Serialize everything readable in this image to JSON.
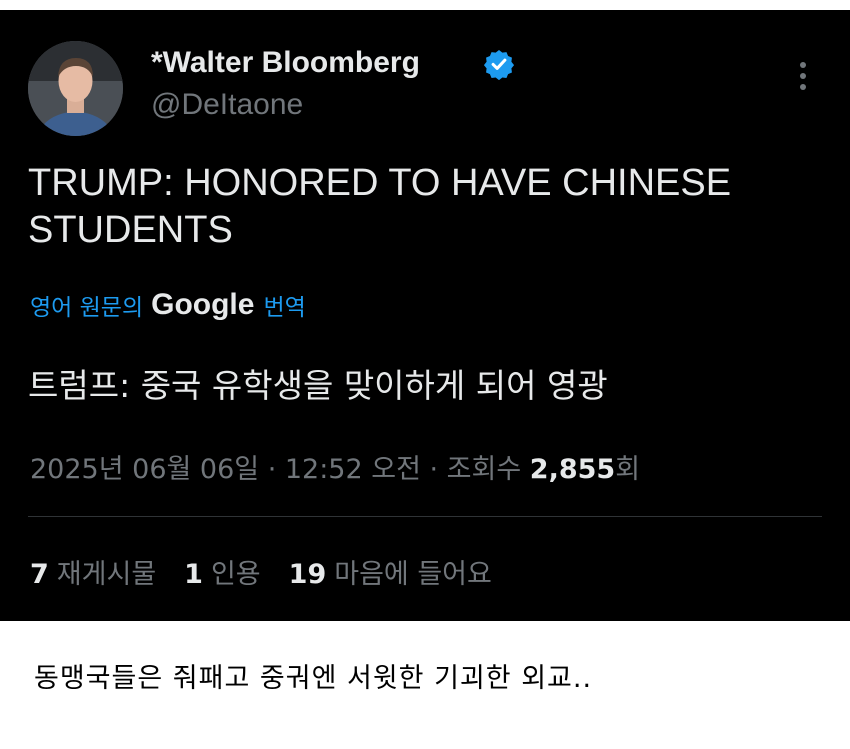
{
  "tweet": {
    "display_name": "*Walter Bloomberg",
    "handle": "@DeItaone",
    "text": "TRUMP: HONORED TO HAVE CHINESE STUDENTS",
    "translation": {
      "prefix": "영어 원문의",
      "brand": "Google",
      "suffix": "번역",
      "text": "트럼프: 중국 유학생을 맞이하게 되어 영광"
    },
    "meta": {
      "timestamp": "2025년 06월 06일 · 12:52 오전 · 조회수",
      "views": "2,855",
      "views_suffix": "회"
    },
    "stats": [
      {
        "count": "7",
        "label": "재게시물"
      },
      {
        "count": "1",
        "label": "인용"
      },
      {
        "count": "19",
        "label": "마음에 들어요"
      }
    ]
  },
  "caption": "동맹국들은 줘패고 중궈엔 서윗한 기괴한 외교..",
  "colors": {
    "background": "#000000",
    "text": "#e7e9ea",
    "muted": "#71767b",
    "accent": "#1d9bf0",
    "divider": "#2f3336"
  },
  "icons": [
    "avatar",
    "verified-badge-icon",
    "more-options-icon"
  ]
}
